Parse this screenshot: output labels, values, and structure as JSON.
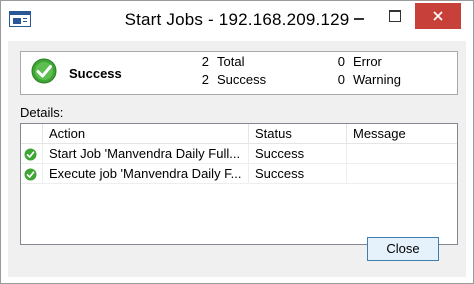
{
  "window": {
    "title": "Start Jobs - 192.168.209.129"
  },
  "summary": {
    "status_label": "Success",
    "total_count": "2",
    "total_label": "Total",
    "success_count": "2",
    "success_label": "Success",
    "error_count": "0",
    "error_label": "Error",
    "warning_count": "0",
    "warning_label": "Warning"
  },
  "details": {
    "label": "Details:",
    "columns": [
      "Action",
      "Status",
      "Message"
    ],
    "rows": [
      {
        "action": "Start Job 'Manvendra Daily Full...",
        "status": "Success",
        "message": ""
      },
      {
        "action": "Execute job 'Manvendra Daily F...",
        "status": "Success",
        "message": ""
      }
    ]
  },
  "buttons": {
    "close_label": "Close"
  },
  "colors": {
    "success_green": "#3fa535",
    "close_red": "#c7413a",
    "button_border": "#3c7fb1"
  },
  "icons": {
    "app": "app-icon",
    "success": "check-circle-icon"
  }
}
